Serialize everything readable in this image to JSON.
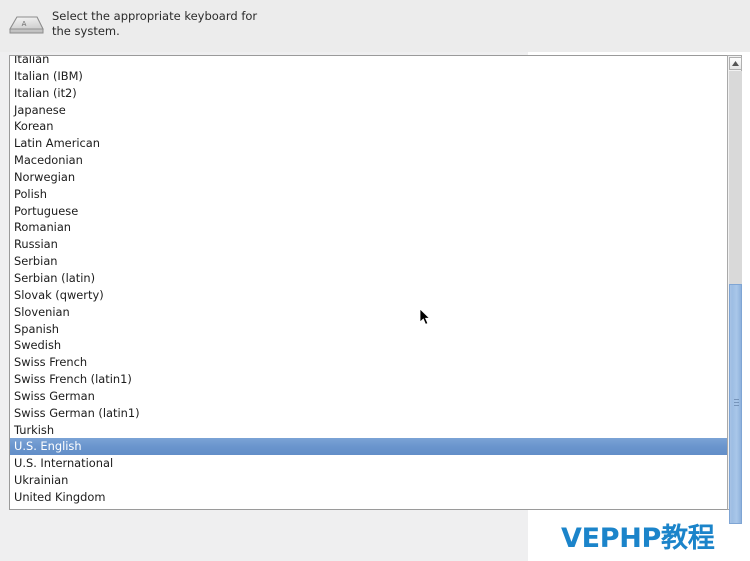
{
  "header": {
    "icon": "keyboard-key-icon",
    "line1": "Select the appropriate keyboard for",
    "line2": "the system."
  },
  "keyboard_list": {
    "selected": "U.S. English",
    "items": [
      "Italian",
      "Italian (IBM)",
      "Italian (it2)",
      "Japanese",
      "Korean",
      "Latin American",
      "Macedonian",
      "Norwegian",
      "Polish",
      "Portuguese",
      "Romanian",
      "Russian",
      "Serbian",
      "Serbian (latin)",
      "Slovak (qwerty)",
      "Slovenian",
      "Spanish",
      "Swedish",
      "Swiss French",
      "Swiss French (latin1)",
      "Swiss German",
      "Swiss German (latin1)",
      "Turkish",
      "U.S. English",
      "U.S. International",
      "Ukrainian",
      "United Kingdom"
    ]
  },
  "scrollbar": {
    "up_arrow": "▲",
    "thumb": "scrollbar-thumb"
  },
  "watermark": {
    "text": "VEPHP教程",
    "color": "#1b84ca"
  },
  "colors": {
    "selection": "#6a95cd",
    "header_bg": "#ececec",
    "panel_bg": "#efeff0",
    "list_bg": "#ffffff"
  }
}
